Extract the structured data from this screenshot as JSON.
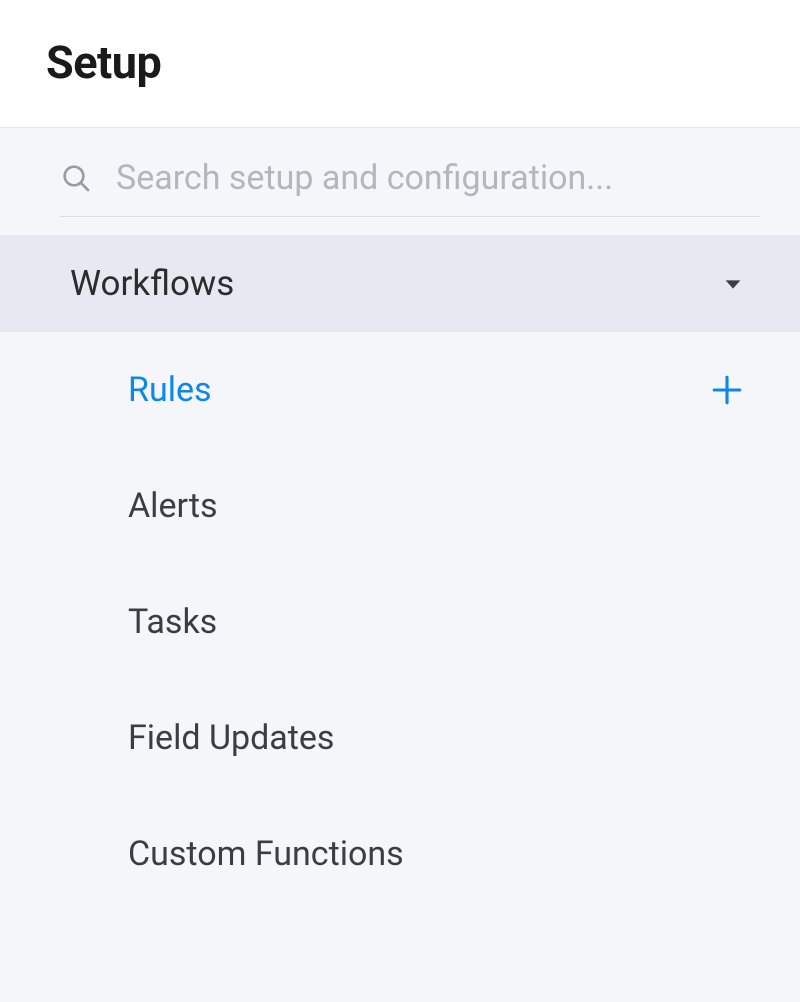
{
  "header": {
    "title": "Setup"
  },
  "search": {
    "placeholder": "Search setup and configuration...",
    "value": ""
  },
  "section": {
    "title": "Workflows",
    "expanded": true
  },
  "menu": {
    "items": [
      {
        "label": "Rules",
        "active": true,
        "has_add": true
      },
      {
        "label": "Alerts",
        "active": false,
        "has_add": false
      },
      {
        "label": "Tasks",
        "active": false,
        "has_add": false
      },
      {
        "label": "Field Updates",
        "active": false,
        "has_add": false
      },
      {
        "label": "Custom Functions",
        "active": false,
        "has_add": false
      }
    ]
  },
  "colors": {
    "accent": "#0d87ea",
    "section_bg": "#e6e9f2",
    "body_bg": "#f5f6f9"
  }
}
